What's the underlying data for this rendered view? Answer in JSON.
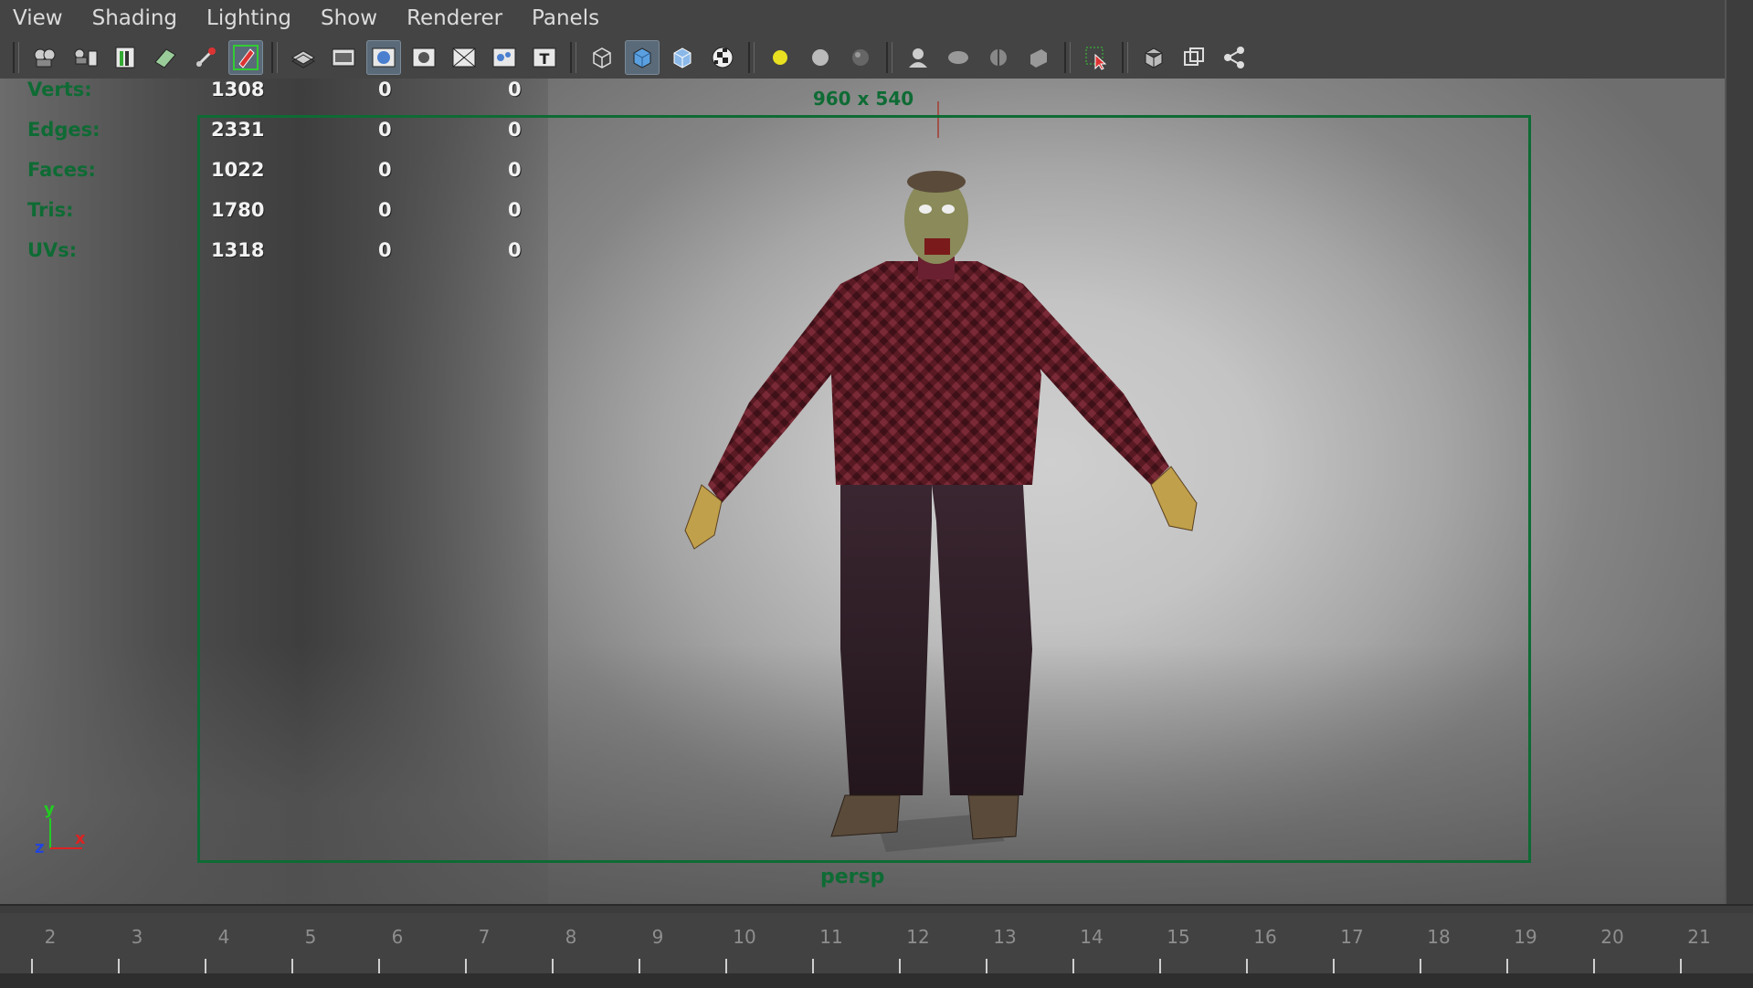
{
  "menu": [
    "View",
    "Shading",
    "Lighting",
    "Show",
    "Renderer",
    "Panels"
  ],
  "toolbar_icons": [
    "camera-select-icon",
    "camera-attributes-icon",
    "bookmark-icon",
    "image-plane-icon",
    "two-d-pan-zoom-icon",
    "grease-pencil-icon",
    "grid-icon",
    "film-gate-icon",
    "resolution-gate-icon",
    "gate-mask-icon",
    "field-chart-icon",
    "safe-action-icon",
    "safe-title-icon",
    "wireframe-icon",
    "smooth-shade-icon",
    "wireframe-on-shaded-icon",
    "textured-icon",
    "use-all-lights-icon",
    "shadows-icon",
    "screen-space-ao-icon",
    "motion-blur-icon",
    "anti-aliasing-icon",
    "depth-of-field-icon",
    "xray-icon",
    "isolate-select-icon",
    "xray-joints-icon",
    "xray-active-components-icon",
    "hud-toggle-icon"
  ],
  "hud": {
    "rows": [
      {
        "label": "Verts:",
        "a": "1308",
        "b": "0",
        "c": "0"
      },
      {
        "label": "Edges:",
        "a": "2331",
        "b": "0",
        "c": "0"
      },
      {
        "label": "Faces:",
        "a": "1022",
        "b": "0",
        "c": "0"
      },
      {
        "label": "Tris:",
        "a": "1780",
        "b": "0",
        "c": "0"
      },
      {
        "label": "UVs:",
        "a": "1318",
        "b": "0",
        "c": "0"
      }
    ]
  },
  "viewport": {
    "resolution": "960 x 540",
    "camera": "persp",
    "gate_color": "#0e6b34"
  },
  "axis": {
    "y": "y",
    "z": "z",
    "x": "x"
  },
  "timeline": {
    "ticks": [
      "2",
      "3",
      "4",
      "5",
      "6",
      "7",
      "8",
      "9",
      "10",
      "11",
      "12",
      "13",
      "14",
      "15",
      "16",
      "17",
      "18",
      "19",
      "20",
      "21"
    ]
  }
}
